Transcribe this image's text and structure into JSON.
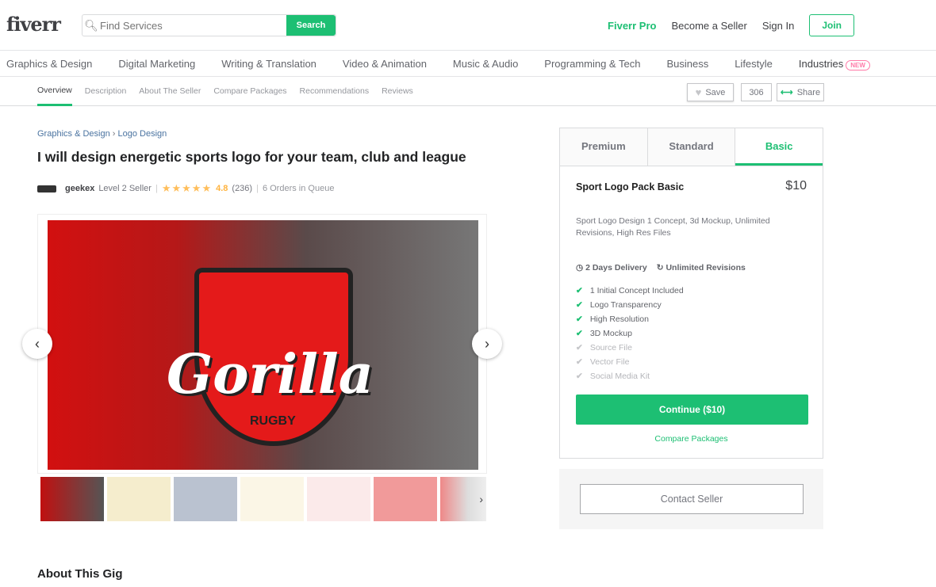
{
  "header": {
    "logo": "fiverr",
    "search_placeholder": "Find Services",
    "search_button": "Search",
    "links": [
      "Fiverr Pro",
      "Become a Seller",
      "Sign In"
    ],
    "join": "Join"
  },
  "categories": [
    "Graphics & Design",
    "Digital Marketing",
    "Writing & Translation",
    "Video & Animation",
    "Music & Audio",
    "Programming & Tech",
    "Business",
    "Lifestyle",
    "Industries"
  ],
  "new_badge": "NEW",
  "subnav": {
    "tabs": [
      "Overview",
      "Description",
      "About The Seller",
      "Compare Packages",
      "Recommendations",
      "Reviews"
    ],
    "save": "Save",
    "save_count": "306",
    "share": "Share"
  },
  "breadcrumb": {
    "parent": "Graphics & Design",
    "sep": "›",
    "current": "Logo Design"
  },
  "gig": {
    "title": "I will design energetic sports logo for your team, club and league",
    "seller": "geekex",
    "level": "Level 2 Seller",
    "rating": "4.8",
    "reviews": "(236)",
    "queue": "6 Orders in Queue",
    "image_lettering": "Gorilla RUGBY"
  },
  "package": {
    "tabs": [
      "Premium",
      "Standard",
      "Basic"
    ],
    "name": "Sport Logo Pack Basic",
    "price": "$10",
    "description": "Sport Logo Design 1 Concept, 3d Mockup, Unlimited Revisions, High Res Files",
    "delivery": "2 Days Delivery",
    "revisions": "Unlimited Revisions",
    "features": [
      {
        "label": "1 Initial Concept Included",
        "included": true
      },
      {
        "label": "Logo Transparency",
        "included": true
      },
      {
        "label": "High Resolution",
        "included": true
      },
      {
        "label": "3D Mockup",
        "included": true
      },
      {
        "label": "Source File",
        "included": false
      },
      {
        "label": "Vector File",
        "included": false
      },
      {
        "label": "Social Media Kit",
        "included": false
      }
    ],
    "continue": "Continue ($10)",
    "compare": "Compare Packages"
  },
  "contact": "Contact Seller",
  "about": "About This Gig",
  "colors": {
    "accent": "#1dbf73",
    "star": "#ffbe5b"
  }
}
